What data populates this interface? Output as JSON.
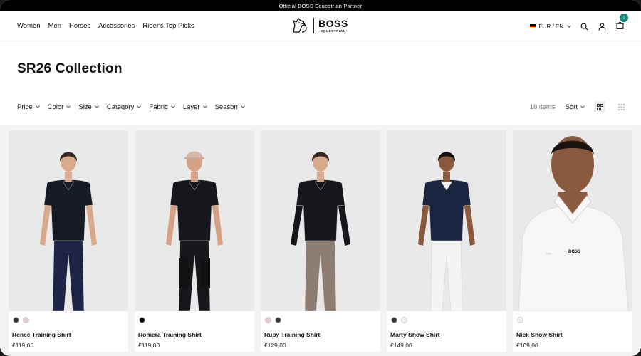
{
  "announcement": "Official BOSS Equestrian Partner",
  "nav": [
    "Women",
    "Men",
    "Horses",
    "Accessories",
    "Rider's Top Picks"
  ],
  "logo": {
    "brand": "BOSS",
    "sub": "EQUESTRIAN"
  },
  "locale": "EUR / EN",
  "cart_count": "1",
  "page_title": "SR26 Collection",
  "filters": [
    "Price",
    "Color",
    "Size",
    "Category",
    "Fabric",
    "Layer",
    "Season"
  ],
  "item_count": "18 items",
  "sort_label": "Sort",
  "products": [
    {
      "name": "Renee Training Shirt",
      "price": "€119,00",
      "swatches": [
        "#3a3a3a",
        "#e6c9dc"
      ],
      "top": "#161a22",
      "bottom": "#1e2445",
      "collar": "#161a22",
      "skin": "#d8a98a",
      "hair": "#3a2a20",
      "sleeves": "short",
      "hat": false,
      "boots": false
    },
    {
      "name": "Romera Training Shirt",
      "price": "€119,00",
      "swatches": [
        "#0a0a0a"
      ],
      "top": "#15171c",
      "bottom": "#15171c",
      "collar": "#15171c",
      "skin": "#d6a286",
      "hair": "#3a2a20",
      "sleeves": "short",
      "hat": true,
      "boots": true
    },
    {
      "name": "Ruby Training Shirt",
      "price": "€129,00",
      "swatches": [
        "#e6c9dc",
        "#3a3f4a"
      ],
      "top": "#15171c",
      "bottom": "#8d7d72",
      "collar": "#15171c",
      "skin": "#d8a98a",
      "hair": "#3a2a20",
      "sleeves": "long",
      "hat": false,
      "boots": false
    },
    {
      "name": "Marty Show Shirt",
      "price": "€149,00",
      "swatches": [
        "#3a3a3a",
        "#f0f0f0"
      ],
      "top": "#1c2540",
      "bottom": "#f4f4f4",
      "collar": "#f4f4f4",
      "skin": "#8a5a3e",
      "hair": "#1a1410",
      "sleeves": "short",
      "hat": false,
      "boots": false
    },
    {
      "name": "Nick Show Shirt",
      "price": "€169,00",
      "swatches": [
        "#f0f0f0"
      ],
      "top": "#f7f7f7",
      "bottom": "#f7f7f7",
      "collar": "#f7f7f7",
      "skin": "#8a5a3e",
      "hair": "#1a1410",
      "sleeves": "close",
      "hat": false,
      "boots": false
    }
  ]
}
